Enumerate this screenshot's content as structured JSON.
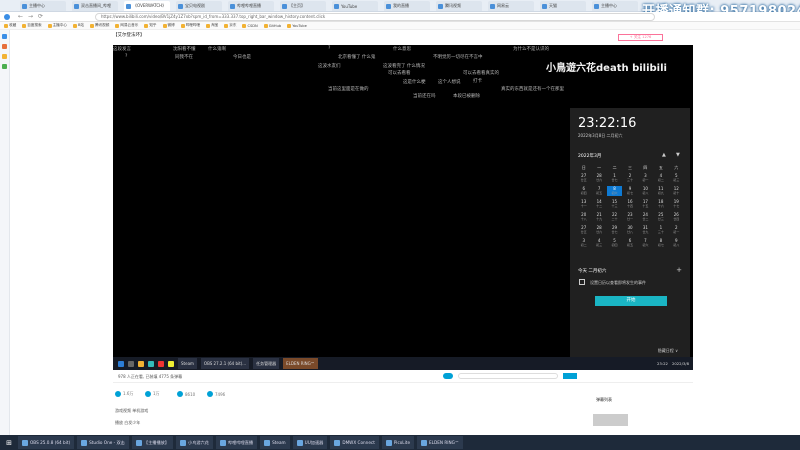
{
  "banner": {
    "text": "开播通知群: 957198024"
  },
  "browser": {
    "tabs": [
      "主播中心",
      "双击直播间_哔哩",
      "《OVERWATCH》",
      "宝贝电视剧",
      "哔哩哔哩直播",
      "【主页】",
      "YouTube",
      "我的直播",
      "腾讯视频",
      "网易云",
      "天猫",
      "主播中心"
    ],
    "address": "https://www.bilibili.com/video/BV1jZ4y1Z7xb?spm_id_from=333.337.top_right_bar_window_history.content.click",
    "bookmarks": [
      "收藏",
      "百度搜索",
      "主播中心",
      "B站",
      "腾讯视频",
      "网易云音乐",
      "知乎",
      "微博",
      "哔哩哔哩",
      "淘宝",
      "京东",
      "CSDN",
      "GitHub",
      "YouTube"
    ]
  },
  "video": {
    "watermark": "小鳥遊六花death bilibili",
    "danmu": [
      "这段发言",
      "沈阳看不懂",
      "什么鬼啊",
      "?",
      "什么意思",
      "为什么不是认识的",
      "?",
      "同我不在",
      "今日也是",
      "北京看懂了 什么鬼",
      "不明觉厉一切尽在不言中",
      "这波水友们",
      "这波看完了 什么情况",
      "可以去看看",
      "可以去看看真实的",
      "打卡",
      "这是什么梗",
      "这个人想说",
      "真实的东西就是还有一个在那里",
      "当前这里面是在做的",
      "当前还在吗",
      "本段已被删除"
    ]
  },
  "calendar": {
    "time": "23:22:16",
    "date": "2022年3月8日 二月初六",
    "month": "2022年3月",
    "weekdays": [
      "日",
      "一",
      "二",
      "三",
      "四",
      "五",
      "六"
    ],
    "days": [
      [
        "27",
        "廿五"
      ],
      [
        "28",
        "廿六"
      ],
      [
        "1",
        "廿七"
      ],
      [
        "2",
        "三十"
      ],
      [
        "3",
        "初一"
      ],
      [
        "4",
        "初二"
      ],
      [
        "5",
        "初三"
      ],
      [
        "6",
        "初四"
      ],
      [
        "7",
        "初五"
      ],
      [
        "8",
        "初六"
      ],
      [
        "9",
        "初七"
      ],
      [
        "10",
        "初八"
      ],
      [
        "11",
        "初九"
      ],
      [
        "12",
        "初十"
      ],
      [
        "13",
        "十一"
      ],
      [
        "14",
        "十二"
      ],
      [
        "15",
        "十三"
      ],
      [
        "16",
        "十四"
      ],
      [
        "17",
        "十五"
      ],
      [
        "18",
        "十六"
      ],
      [
        "19",
        "十七"
      ],
      [
        "20",
        "十八"
      ],
      [
        "21",
        "十九"
      ],
      [
        "22",
        "二十"
      ],
      [
        "23",
        "廿一"
      ],
      [
        "24",
        "廿二"
      ],
      [
        "25",
        "廿三"
      ],
      [
        "26",
        "廿四"
      ],
      [
        "27",
        "廿五"
      ],
      [
        "28",
        "廿六"
      ],
      [
        "29",
        "廿七"
      ],
      [
        "30",
        "廿八"
      ],
      [
        "31",
        "廿九"
      ],
      [
        "1",
        "三十"
      ],
      [
        "2",
        "初一"
      ],
      [
        "3",
        "初二"
      ],
      [
        "4",
        "初三"
      ],
      [
        "5",
        "初四"
      ],
      [
        "6",
        "初五"
      ],
      [
        "7",
        "初六"
      ],
      [
        "8",
        "初七"
      ],
      [
        "9",
        "初八"
      ]
    ],
    "today_label": "今天 二月初六",
    "event": "设置日历以查看即将发生的事件",
    "start_button": "开始",
    "hide_label": "隐藏日程 ∨"
  },
  "inner_taskbar": {
    "apps": [
      "Steam",
      "OBS 27.2.1 (64 bit)...",
      "任务管理器",
      "ELDEN RING™"
    ],
    "time": "23:22",
    "date": "2022/3/8"
  },
  "video_info": {
    "viewers": "978 人正在看, 已装填 4775 条弹幕",
    "like": "1.6万",
    "coin": "1万",
    "fav": "8610",
    "share": "7496",
    "tags": "游戏视频    单机游戏",
    "note": "播放 白发少年",
    "recommend": "弹幕列表"
  },
  "os_taskbar": {
    "items": [
      "OBS 25.0.8 (64 bit)",
      "Studio One - 双击",
      "【主播播放】",
      "小鸟游六花",
      "哔哩哔哩直播",
      "Steam",
      "UU加速器",
      "DMWX Connect",
      "PicoLite",
      "ELDEN RING™"
    ]
  },
  "colors": {
    "accent": "#00a1d6",
    "calendar_bg": "#202020",
    "start": "#1ab5c4",
    "today": "#0e7ad3"
  }
}
